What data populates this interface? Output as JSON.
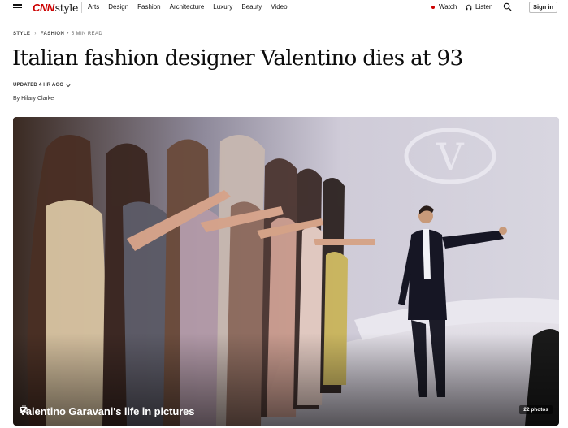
{
  "nav": {
    "logo_brand": "CNN",
    "logo_section": "style",
    "links": [
      "Arts",
      "Design",
      "Fashion",
      "Architecture",
      "Luxury",
      "Beauty",
      "Video"
    ],
    "watch_label": "Watch",
    "listen_label": "Listen",
    "signin_label": "Sign in",
    "accent_color": "#cc0000"
  },
  "breadcrumb": {
    "section": "Style",
    "subsection": "Fashion",
    "read_time": "5 min read"
  },
  "article": {
    "headline": "Italian fashion designer Valentino dies at 93",
    "updated": "Updated 4 hr ago",
    "byline": "By Hilary Clarke"
  },
  "hero": {
    "caption": "Valentino Garavani's life in pictures",
    "photo_count": "22 photos",
    "logo_letter": "V"
  },
  "icons": {
    "menu": "hamburger-menu-icon",
    "headphones": "headphones-icon",
    "search": "search-icon",
    "gallery": "gallery-icon",
    "chevron": "chevron-down-icon"
  }
}
